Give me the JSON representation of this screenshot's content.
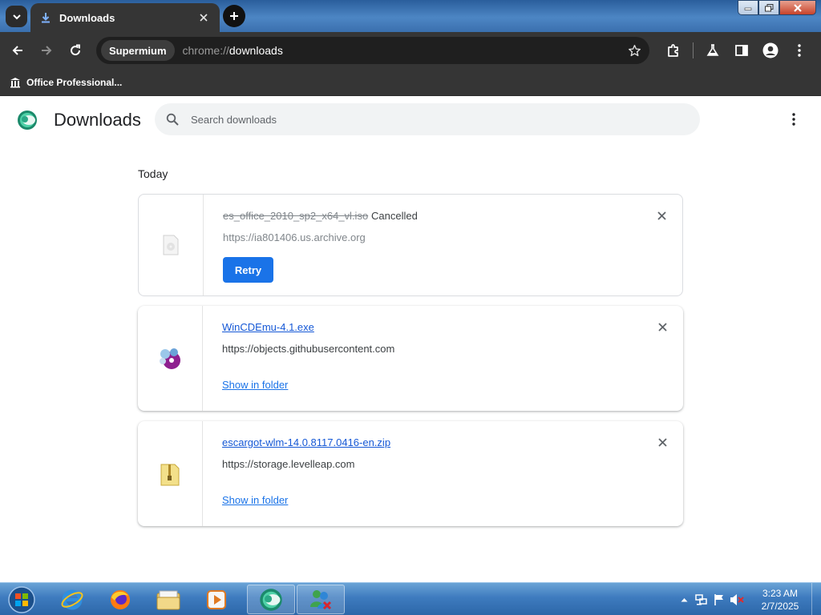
{
  "browser": {
    "tab_title": "Downloads",
    "profile_chip": "Supermium",
    "url_scheme": "chrome://",
    "url_host": "downloads",
    "bookmark": "Office Professional..."
  },
  "page": {
    "title": "Downloads",
    "search_placeholder": "Search downloads",
    "date_heading": "Today"
  },
  "downloads": [
    {
      "filename": "es_office_2010_sp2_x64_vl.iso",
      "status": "Cancelled",
      "source": "https://ia801406.us.archive.org",
      "action": "Retry",
      "icon": "blank-file-icon"
    },
    {
      "filename": "WinCDEmu-4.1.exe",
      "source": "https://objects.githubusercontent.com",
      "action": "Show in folder",
      "icon": "wincdemu-app-icon"
    },
    {
      "filename": "escargot-wlm-14.0.8117.0416-en.zip",
      "source": "https://storage.levelleap.com",
      "action": "Show in folder",
      "icon": "zip-folder-icon"
    }
  ],
  "taskbar": {
    "time": "3:23 AM",
    "date": "2/7/2025",
    "apps": [
      "internet-explorer-icon",
      "firefox-icon",
      "file-explorer-icon",
      "media-player-icon",
      "supermium-icon",
      "messenger-icon"
    ]
  },
  "colors": {
    "toolbar": "#353535",
    "link": "#1a73e8",
    "retry_button": "#1a73e8",
    "taskbar": "#3e7bbf"
  }
}
